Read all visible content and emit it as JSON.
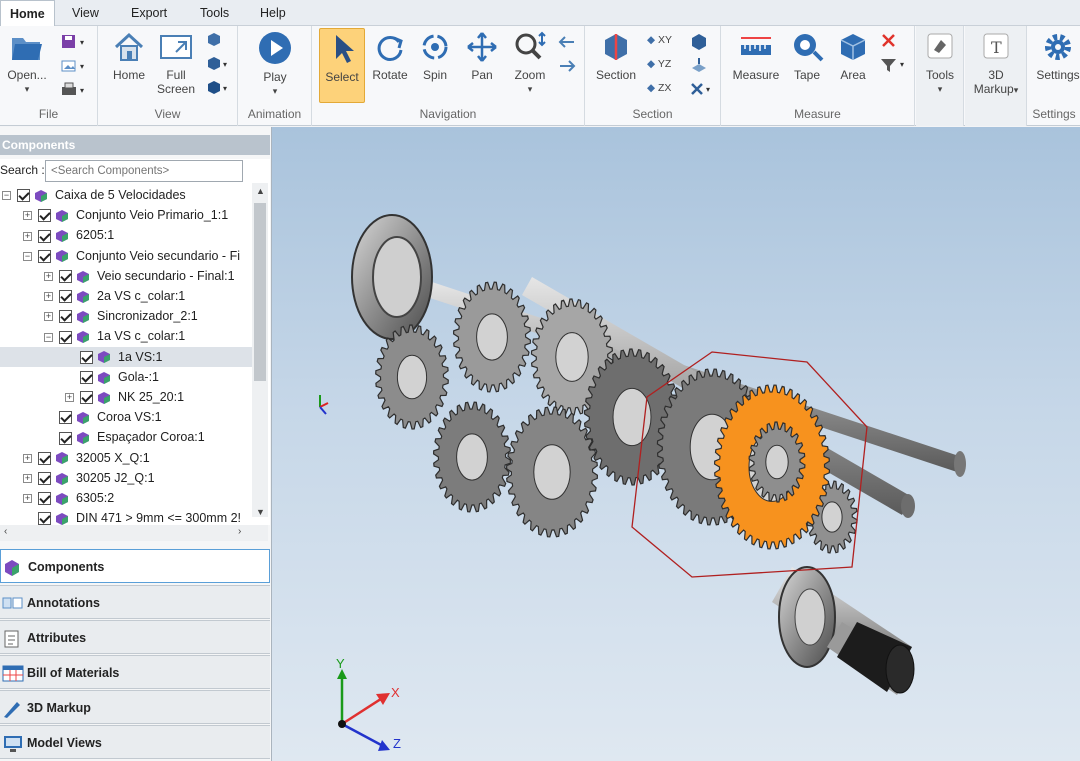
{
  "menu": {
    "items": [
      "Home",
      "View",
      "Export",
      "Tools",
      "Help"
    ],
    "active": "Home"
  },
  "ribbon": {
    "groups": {
      "file": "File",
      "view": "View",
      "animation": "Animation",
      "navigation": "Navigation",
      "section": "Section",
      "measure": "Measure",
      "settings": "Settings"
    },
    "buttons": {
      "open": "Open...",
      "home": "Home",
      "full_screen_1": "Full",
      "full_screen_2": "Screen",
      "play": "Play",
      "select": "Select",
      "rotate": "Rotate",
      "spin": "Spin",
      "pan": "Pan",
      "zoom": "Zoom",
      "section": "Section",
      "xy": "XY",
      "yz": "YZ",
      "zx": "ZX",
      "measure": "Measure",
      "tape": "Tape",
      "area": "Area",
      "tools": "Tools",
      "markup_1": "3D",
      "markup_2": "Markup",
      "settings": "Settings"
    }
  },
  "panel": {
    "title": "Components",
    "search_label": "Search :",
    "search_placeholder": "<Search Components>",
    "tree": [
      "Caixa de 5 Velocidades",
      "Conjunto Veio Primario_1:1",
      "6205:1",
      "Conjunto Veio secundario - Fi",
      "Veio secundario - Final:1",
      "2a VS c_colar:1",
      "Sincronizador_2:1",
      "1a VS c_colar:1",
      "1a VS:1",
      "Gola-:1",
      "NK 25_20:1",
      "Coroa VS:1",
      "Espaçador Coroa:1",
      "32005 X_Q:1",
      "30205 J2_Q:1",
      "6305:2",
      "DIN 471 > 9mm <= 300mm 2!"
    ],
    "bottom_buttons": [
      "Components",
      "Annotations",
      "Attributes",
      "Bill of Materials",
      "3D Markup",
      "Model Views"
    ]
  },
  "axes": {
    "x": "X",
    "y": "Y",
    "z": "Z"
  },
  "colors": {
    "highlight": "#f7921e",
    "selected_button": "#fdd27a",
    "viewport_top": "#a9c3dc",
    "viewport_bottom": "#dfe8f1"
  }
}
